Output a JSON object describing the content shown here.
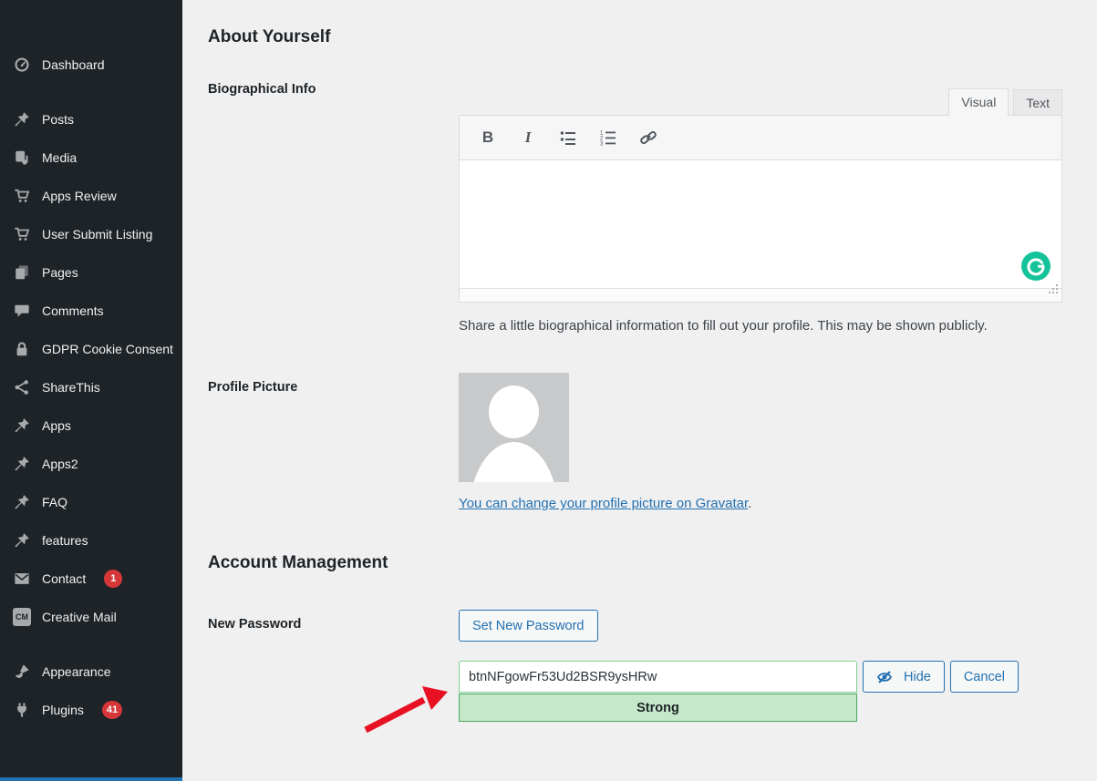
{
  "sidebar": {
    "items": [
      {
        "label": "Dashboard",
        "icon": "dashboard",
        "gap_after": true
      },
      {
        "label": "Posts",
        "icon": "pin"
      },
      {
        "label": "Media",
        "icon": "media"
      },
      {
        "label": "Apps Review",
        "icon": "cart"
      },
      {
        "label": "User Submit Listing",
        "icon": "cart"
      },
      {
        "label": "Pages",
        "icon": "pages"
      },
      {
        "label": "Comments",
        "icon": "comment"
      },
      {
        "label": "GDPR Cookie Consent",
        "icon": "lock"
      },
      {
        "label": "ShareThis",
        "icon": "share"
      },
      {
        "label": "Apps",
        "icon": "pin"
      },
      {
        "label": "Apps2",
        "icon": "pin"
      },
      {
        "label": "FAQ",
        "icon": "pin"
      },
      {
        "label": "features",
        "icon": "pin"
      },
      {
        "label": "Contact",
        "icon": "mail",
        "badge": "1"
      },
      {
        "label": "Creative Mail",
        "icon": "cm",
        "gap_after": true
      },
      {
        "label": "Appearance",
        "icon": "brush"
      },
      {
        "label": "Plugins",
        "icon": "plugin",
        "badge": "41"
      }
    ]
  },
  "main": {
    "about_heading": "About Yourself",
    "bio": {
      "label": "Biographical Info",
      "tab_visual": "Visual",
      "tab_text": "Text",
      "toolbar_icons": [
        "bold",
        "italic",
        "bullet-list",
        "numbered-list",
        "link"
      ],
      "description": "Share a little biographical information to fill out your profile. This may be shown publicly."
    },
    "profile_picture": {
      "label": "Profile Picture",
      "link_text": "You can change your profile picture on Gravatar",
      "link_suffix": "."
    },
    "account_heading": "Account Management",
    "new_password": {
      "label": "New Password",
      "set_button_label": "Set New Password",
      "value": "btnNFgowFr53Ud2BSR9ysHRw",
      "strength_label": "Strong",
      "hide_button_label": "Hide",
      "cancel_button_label": "Cancel"
    }
  },
  "colors": {
    "sidebar_bg": "#1d2327",
    "accent_blue": "#2271b1",
    "badge_red": "#d63638",
    "strength_strong_bg": "#c5e8ca",
    "strength_strong_border": "#4aa85c",
    "grammarly_green": "#15c39a",
    "annotation_arrow_red": "#e81123"
  }
}
